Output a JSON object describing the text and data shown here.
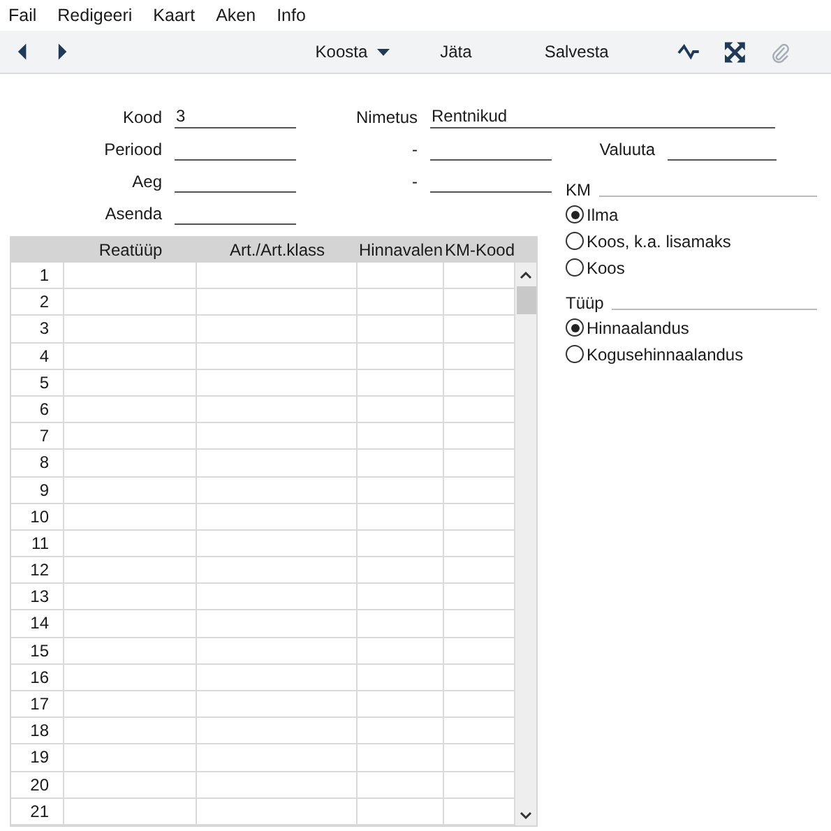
{
  "menu": [
    "Fail",
    "Redigeeri",
    "Kaart",
    "Aken",
    "Info"
  ],
  "toolbar": {
    "actions": [
      {
        "label": "Koosta",
        "kind": "dropdown"
      },
      {
        "label": "Jäta",
        "kind": "plain"
      },
      {
        "label": "Salvesta",
        "kind": "plain"
      }
    ],
    "attach_disabled": true
  },
  "form": {
    "kood": {
      "label": "Kood",
      "value": "3"
    },
    "nimetus": {
      "label": "Nimetus",
      "value": "Rentnikud"
    },
    "periood": {
      "label": "Periood",
      "sep": "-"
    },
    "valuuta": {
      "label": "Valuuta"
    },
    "aeg": {
      "label": "Aeg",
      "sep": "-"
    },
    "asenda": {
      "label": "Asenda"
    }
  },
  "table": {
    "columns": [
      "Reatüüp",
      "Art./Art.klass",
      "Hinnavalen",
      "KM-Kood"
    ],
    "rows": [
      "1",
      "2",
      "3",
      "4",
      "5",
      "6",
      "7",
      "8",
      "9",
      "10",
      "11",
      "12",
      "13",
      "14",
      "15",
      "16",
      "17",
      "18",
      "19",
      "20",
      "21"
    ]
  },
  "groups": [
    {
      "label": "KM",
      "options": [
        {
          "label": "Ilma",
          "selected": true
        },
        {
          "label": "Koos, k.a. lisamaks",
          "selected": false
        },
        {
          "label": "Koos",
          "selected": false
        }
      ]
    },
    {
      "label": "Tüüp",
      "options": [
        {
          "label": "Hinnaalandus",
          "selected": true
        },
        {
          "label": "Kogusehinnaalandus",
          "selected": false
        }
      ]
    }
  ]
}
